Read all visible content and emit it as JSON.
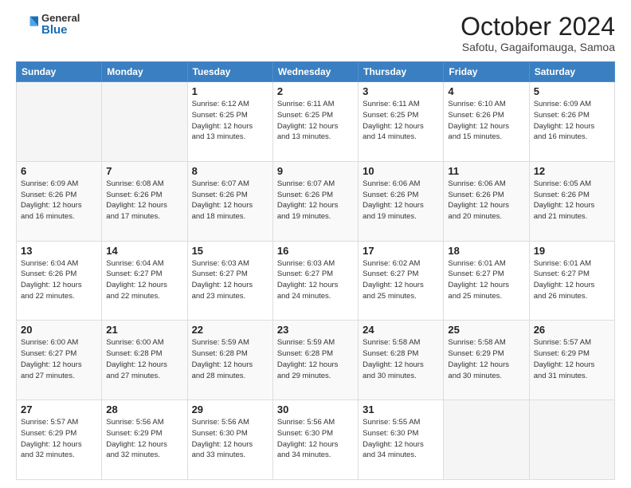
{
  "header": {
    "logo_general": "General",
    "logo_blue": "Blue",
    "month_title": "October 2024",
    "location": "Safotu, Gagaifomauga, Samoa"
  },
  "days_of_week": [
    "Sunday",
    "Monday",
    "Tuesday",
    "Wednesday",
    "Thursday",
    "Friday",
    "Saturday"
  ],
  "weeks": [
    [
      {
        "day": "",
        "info": ""
      },
      {
        "day": "",
        "info": ""
      },
      {
        "day": "1",
        "info": "Sunrise: 6:12 AM\nSunset: 6:25 PM\nDaylight: 12 hours\nand 13 minutes."
      },
      {
        "day": "2",
        "info": "Sunrise: 6:11 AM\nSunset: 6:25 PM\nDaylight: 12 hours\nand 13 minutes."
      },
      {
        "day": "3",
        "info": "Sunrise: 6:11 AM\nSunset: 6:25 PM\nDaylight: 12 hours\nand 14 minutes."
      },
      {
        "day": "4",
        "info": "Sunrise: 6:10 AM\nSunset: 6:26 PM\nDaylight: 12 hours\nand 15 minutes."
      },
      {
        "day": "5",
        "info": "Sunrise: 6:09 AM\nSunset: 6:26 PM\nDaylight: 12 hours\nand 16 minutes."
      }
    ],
    [
      {
        "day": "6",
        "info": "Sunrise: 6:09 AM\nSunset: 6:26 PM\nDaylight: 12 hours\nand 16 minutes."
      },
      {
        "day": "7",
        "info": "Sunrise: 6:08 AM\nSunset: 6:26 PM\nDaylight: 12 hours\nand 17 minutes."
      },
      {
        "day": "8",
        "info": "Sunrise: 6:07 AM\nSunset: 6:26 PM\nDaylight: 12 hours\nand 18 minutes."
      },
      {
        "day": "9",
        "info": "Sunrise: 6:07 AM\nSunset: 6:26 PM\nDaylight: 12 hours\nand 19 minutes."
      },
      {
        "day": "10",
        "info": "Sunrise: 6:06 AM\nSunset: 6:26 PM\nDaylight: 12 hours\nand 19 minutes."
      },
      {
        "day": "11",
        "info": "Sunrise: 6:06 AM\nSunset: 6:26 PM\nDaylight: 12 hours\nand 20 minutes."
      },
      {
        "day": "12",
        "info": "Sunrise: 6:05 AM\nSunset: 6:26 PM\nDaylight: 12 hours\nand 21 minutes."
      }
    ],
    [
      {
        "day": "13",
        "info": "Sunrise: 6:04 AM\nSunset: 6:26 PM\nDaylight: 12 hours\nand 22 minutes."
      },
      {
        "day": "14",
        "info": "Sunrise: 6:04 AM\nSunset: 6:27 PM\nDaylight: 12 hours\nand 22 minutes."
      },
      {
        "day": "15",
        "info": "Sunrise: 6:03 AM\nSunset: 6:27 PM\nDaylight: 12 hours\nand 23 minutes."
      },
      {
        "day": "16",
        "info": "Sunrise: 6:03 AM\nSunset: 6:27 PM\nDaylight: 12 hours\nand 24 minutes."
      },
      {
        "day": "17",
        "info": "Sunrise: 6:02 AM\nSunset: 6:27 PM\nDaylight: 12 hours\nand 25 minutes."
      },
      {
        "day": "18",
        "info": "Sunrise: 6:01 AM\nSunset: 6:27 PM\nDaylight: 12 hours\nand 25 minutes."
      },
      {
        "day": "19",
        "info": "Sunrise: 6:01 AM\nSunset: 6:27 PM\nDaylight: 12 hours\nand 26 minutes."
      }
    ],
    [
      {
        "day": "20",
        "info": "Sunrise: 6:00 AM\nSunset: 6:27 PM\nDaylight: 12 hours\nand 27 minutes."
      },
      {
        "day": "21",
        "info": "Sunrise: 6:00 AM\nSunset: 6:28 PM\nDaylight: 12 hours\nand 27 minutes."
      },
      {
        "day": "22",
        "info": "Sunrise: 5:59 AM\nSunset: 6:28 PM\nDaylight: 12 hours\nand 28 minutes."
      },
      {
        "day": "23",
        "info": "Sunrise: 5:59 AM\nSunset: 6:28 PM\nDaylight: 12 hours\nand 29 minutes."
      },
      {
        "day": "24",
        "info": "Sunrise: 5:58 AM\nSunset: 6:28 PM\nDaylight: 12 hours\nand 30 minutes."
      },
      {
        "day": "25",
        "info": "Sunrise: 5:58 AM\nSunset: 6:29 PM\nDaylight: 12 hours\nand 30 minutes."
      },
      {
        "day": "26",
        "info": "Sunrise: 5:57 AM\nSunset: 6:29 PM\nDaylight: 12 hours\nand 31 minutes."
      }
    ],
    [
      {
        "day": "27",
        "info": "Sunrise: 5:57 AM\nSunset: 6:29 PM\nDaylight: 12 hours\nand 32 minutes."
      },
      {
        "day": "28",
        "info": "Sunrise: 5:56 AM\nSunset: 6:29 PM\nDaylight: 12 hours\nand 32 minutes."
      },
      {
        "day": "29",
        "info": "Sunrise: 5:56 AM\nSunset: 6:30 PM\nDaylight: 12 hours\nand 33 minutes."
      },
      {
        "day": "30",
        "info": "Sunrise: 5:56 AM\nSunset: 6:30 PM\nDaylight: 12 hours\nand 34 minutes."
      },
      {
        "day": "31",
        "info": "Sunrise: 5:55 AM\nSunset: 6:30 PM\nDaylight: 12 hours\nand 34 minutes."
      },
      {
        "day": "",
        "info": ""
      },
      {
        "day": "",
        "info": ""
      }
    ]
  ]
}
